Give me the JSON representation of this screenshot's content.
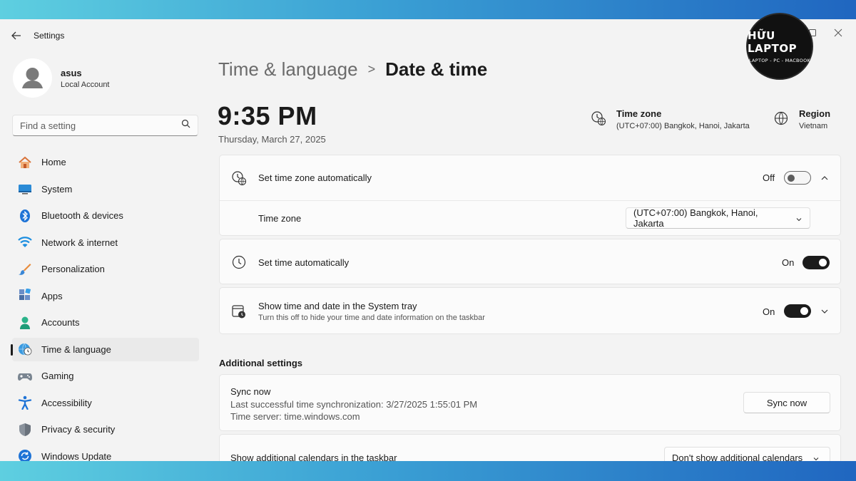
{
  "app": {
    "title": "Settings"
  },
  "profile": {
    "name": "asus",
    "account_type": "Local Account"
  },
  "search": {
    "placeholder": "Find a setting"
  },
  "sidebar": {
    "items": [
      {
        "label": "Home",
        "icon": "home-icon"
      },
      {
        "label": "System",
        "icon": "system-icon"
      },
      {
        "label": "Bluetooth & devices",
        "icon": "bluetooth-icon"
      },
      {
        "label": "Network & internet",
        "icon": "wifi-icon"
      },
      {
        "label": "Personalization",
        "icon": "brush-icon"
      },
      {
        "label": "Apps",
        "icon": "apps-icon"
      },
      {
        "label": "Accounts",
        "icon": "accounts-icon"
      },
      {
        "label": "Time & language",
        "icon": "globe-clock-icon",
        "active": true
      },
      {
        "label": "Gaming",
        "icon": "gamepad-icon"
      },
      {
        "label": "Accessibility",
        "icon": "accessibility-icon"
      },
      {
        "label": "Privacy & security",
        "icon": "shield-icon"
      },
      {
        "label": "Windows Update",
        "icon": "update-icon"
      }
    ]
  },
  "breadcrumb": {
    "parent": "Time & language",
    "separator": ">",
    "current": "Date & time"
  },
  "clock": {
    "time": "9:35 PM",
    "date": "Thursday, March 27, 2025"
  },
  "header_info": {
    "timezone": {
      "title": "Time zone",
      "value": "(UTC+07:00) Bangkok, Hanoi, Jakarta"
    },
    "region": {
      "title": "Region",
      "value": "Vietnam"
    }
  },
  "settings": {
    "tz_auto": {
      "label": "Set time zone automatically",
      "state": "Off"
    },
    "tz_select": {
      "label": "Time zone",
      "value": "(UTC+07:00) Bangkok, Hanoi, Jakarta"
    },
    "time_auto": {
      "label": "Set time automatically",
      "state": "On"
    },
    "tray": {
      "label": "Show time and date in the System tray",
      "sub": "Turn this off to hide your time and date information on the taskbar",
      "state": "On"
    }
  },
  "additional": {
    "title": "Additional settings",
    "sync": {
      "label": "Sync now",
      "last_sync": "Last successful time synchronization: 3/27/2025 1:55:01 PM",
      "server": "Time server: time.windows.com",
      "button": "Sync now"
    },
    "calendars": {
      "label": "Show additional calendars in the taskbar",
      "value": "Don't show additional calendars"
    }
  },
  "logo": {
    "main": "HỮU LAPTOP",
    "sub": "LAPTOP - PC - MACBOOK"
  },
  "colors": {
    "accent": "#1b1b1b",
    "background": "#f3f3f3",
    "card": "#fbfbfb"
  }
}
